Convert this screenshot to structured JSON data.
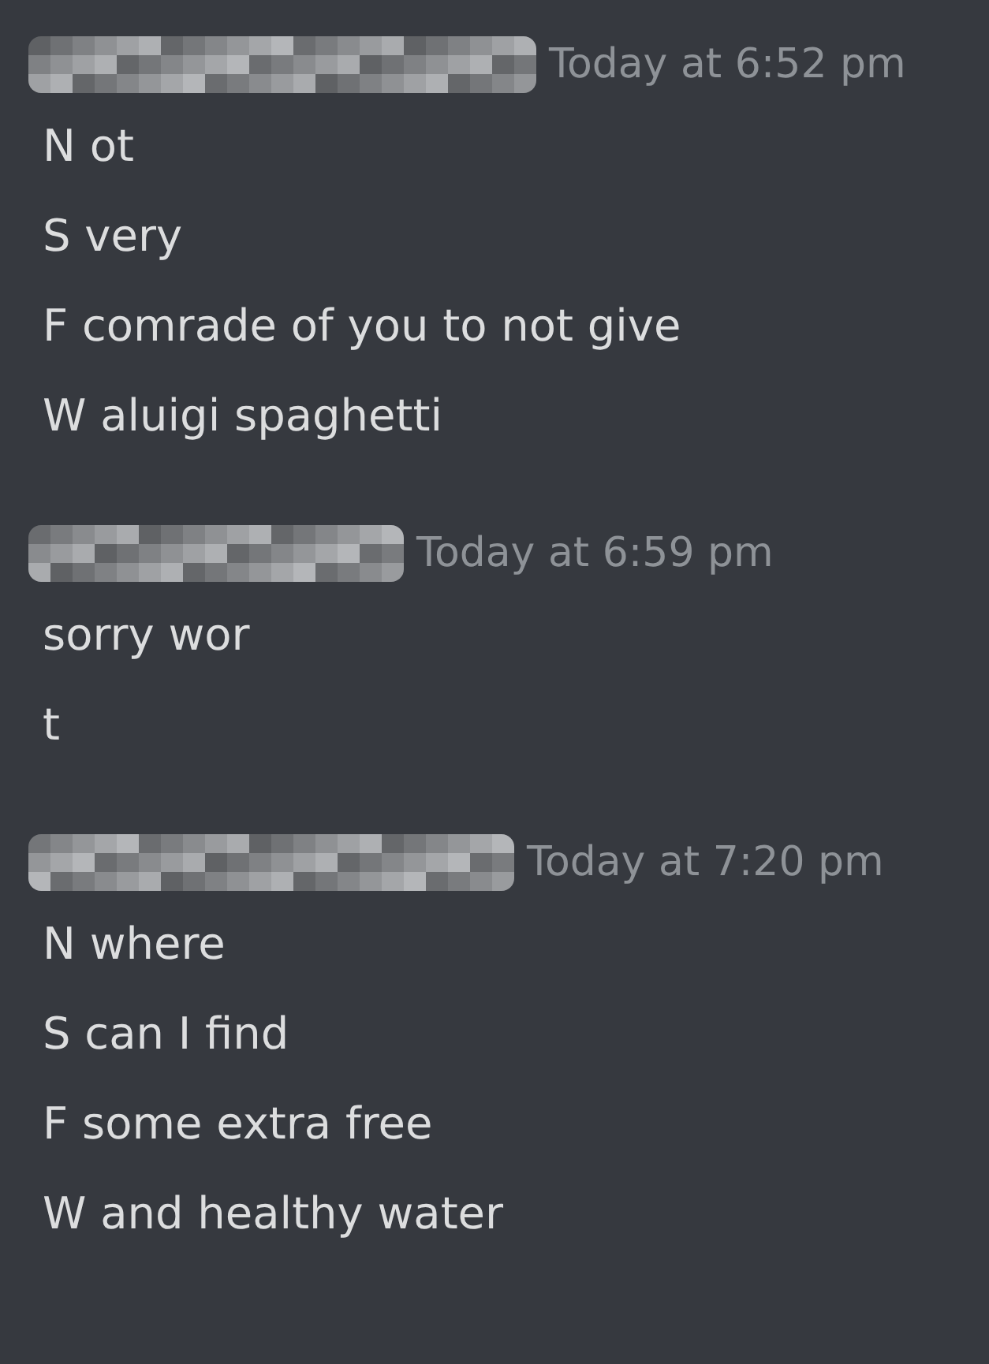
{
  "messages": [
    {
      "timestamp": "Today at 6:52 pm",
      "lines": [
        "N ot",
        "S very",
        "F comrade of you to not give",
        "W aluigi spaghetti"
      ]
    },
    {
      "timestamp": "Today at 6:59 pm",
      "lines": [
        "sorry wor",
        "t"
      ]
    },
    {
      "timestamp": "Today at 7:20 pm",
      "lines": [
        "N where",
        "S can I find",
        "F some extra free",
        "W and healthy water"
      ]
    }
  ]
}
